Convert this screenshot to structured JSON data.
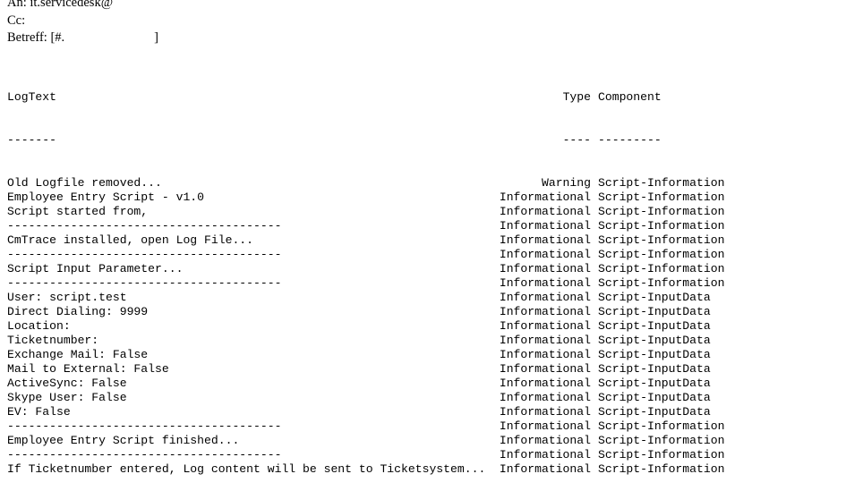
{
  "mail": {
    "to_label": "An:",
    "to_value": "it.servicedesk@",
    "cc_label": "Cc:",
    "cc_value": "",
    "subject_label": "Betreff:",
    "subject_prefix": "[#.",
    "subject_close": "]"
  },
  "log": {
    "headers": {
      "text": "LogText",
      "type": "Type",
      "component": "Component"
    },
    "underlines": {
      "text": "-------",
      "type": "----",
      "component": "---------"
    },
    "rows": [
      {
        "text": "Old Logfile removed...",
        "type": "Warning",
        "component": "Script-Information"
      },
      {
        "text": "Employee Entry Script - v1.0",
        "type": "Informational",
        "component": "Script-Information"
      },
      {
        "text": "Script started from,",
        "type": "Informational",
        "component": "Script-Information"
      },
      {
        "text": "---------------------------------------",
        "type": "Informational",
        "component": "Script-Information"
      },
      {
        "text": "CmTrace installed, open Log File...",
        "type": "Informational",
        "component": "Script-Information"
      },
      {
        "text": "---------------------------------------",
        "type": "Informational",
        "component": "Script-Information"
      },
      {
        "text": "Script Input Parameter...",
        "type": "Informational",
        "component": "Script-Information"
      },
      {
        "text": "---------------------------------------",
        "type": "Informational",
        "component": "Script-Information"
      },
      {
        "text": "User: script.test",
        "type": "Informational",
        "component": "Script-InputData"
      },
      {
        "text": "Direct Dialing: 9999",
        "type": "Informational",
        "component": "Script-InputData"
      },
      {
        "text": "Location:",
        "type": "Informational",
        "component": "Script-InputData"
      },
      {
        "text": "Ticketnumber:",
        "type": "Informational",
        "component": "Script-InputData"
      },
      {
        "text": "Exchange Mail: False",
        "type": "Informational",
        "component": "Script-InputData"
      },
      {
        "text": "Mail to External: False",
        "type": "Informational",
        "component": "Script-InputData"
      },
      {
        "text": "ActiveSync: False",
        "type": "Informational",
        "component": "Script-InputData"
      },
      {
        "text": "Skype User: False",
        "type": "Informational",
        "component": "Script-InputData"
      },
      {
        "text": "EV: False",
        "type": "Informational",
        "component": "Script-InputData"
      },
      {
        "text": "---------------------------------------",
        "type": "Informational",
        "component": "Script-Information"
      },
      {
        "text": "Employee Entry Script finished...",
        "type": "Informational",
        "component": "Script-Information"
      },
      {
        "text": "---------------------------------------",
        "type": "Informational",
        "component": "Script-Information"
      },
      {
        "text": "If Ticketnumber entered, Log content will be sent to Ticketsystem...",
        "type": "Informational",
        "component": "Script-Information"
      }
    ]
  }
}
